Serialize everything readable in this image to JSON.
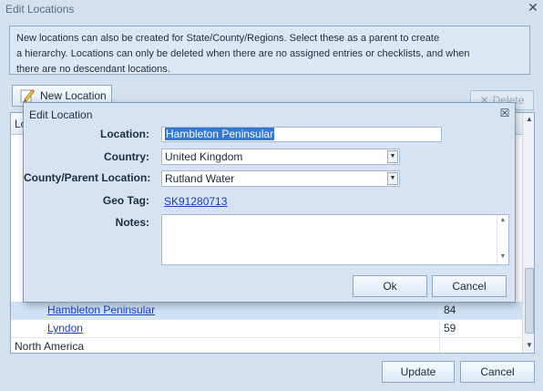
{
  "window": {
    "title": "Edit Locations",
    "close_glyph": "✕"
  },
  "info": {
    "lines": [
      "New locations can also be created for State/County/Regions. Select these as a parent to create",
      "a hierarchy.  Locations can only be deleted when there are no assigned entries or checklists, and when",
      "there are no descendant locations."
    ]
  },
  "toolbar": {
    "new_label": "New Location",
    "new_icon": "pencil-icon",
    "delete_label": "Delete",
    "delete_icon": "x-icon"
  },
  "grid": {
    "header_name": "Lo",
    "rows": [
      {
        "name": "Hambleton Peninsular",
        "count": "84",
        "selected": true,
        "indent": true
      },
      {
        "name": "Lyndon",
        "count": "59",
        "selected": false,
        "indent": true
      },
      {
        "name": "North America",
        "count": "",
        "selected": false,
        "indent": false
      }
    ]
  },
  "footer": {
    "update_label": "Update",
    "cancel_label": "Cancel"
  },
  "dialog": {
    "title": "Edit Location",
    "close_glyph": "☒",
    "location_label": "Location:",
    "location_value": "Hambleton Peninsular",
    "country_label": "Country:",
    "country_value": "United Kingdom",
    "county_label": "County/Parent Location:",
    "county_value": "Rutland Water",
    "geotag_label": "Geo Tag:",
    "geotag_value": "SK91280713",
    "notes_label": "Notes:",
    "notes_value": "",
    "ok_label": "Ok",
    "cancel_label": "Cancel"
  }
}
